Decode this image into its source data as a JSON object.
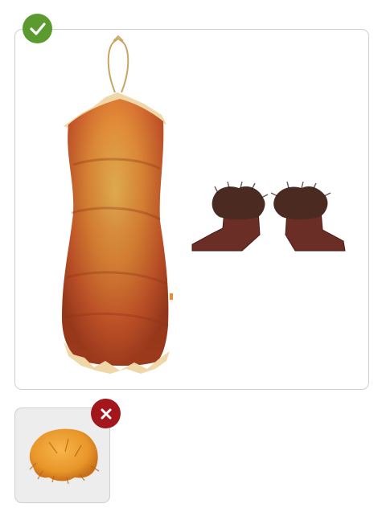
{
  "colors": {
    "included_badge": "#5a9a2e",
    "excluded_badge": "#a3161b",
    "card_border": "#cfcfcf",
    "excluded_card_bg": "#ededed",
    "dress_orange": "#e07a2c",
    "dress_trim": "#f0d7a8",
    "boot_brown": "#6b2e26",
    "wig_orange": "#e8962a"
  },
  "included": {
    "badge_icon": "checkmark-icon",
    "items": [
      {
        "icon": "caveman-dress-icon"
      },
      {
        "icon": "fur-boots-icon"
      }
    ]
  },
  "excluded": {
    "badge_icon": "close-icon",
    "items": [
      {
        "icon": "orange-wig-icon"
      }
    ]
  }
}
